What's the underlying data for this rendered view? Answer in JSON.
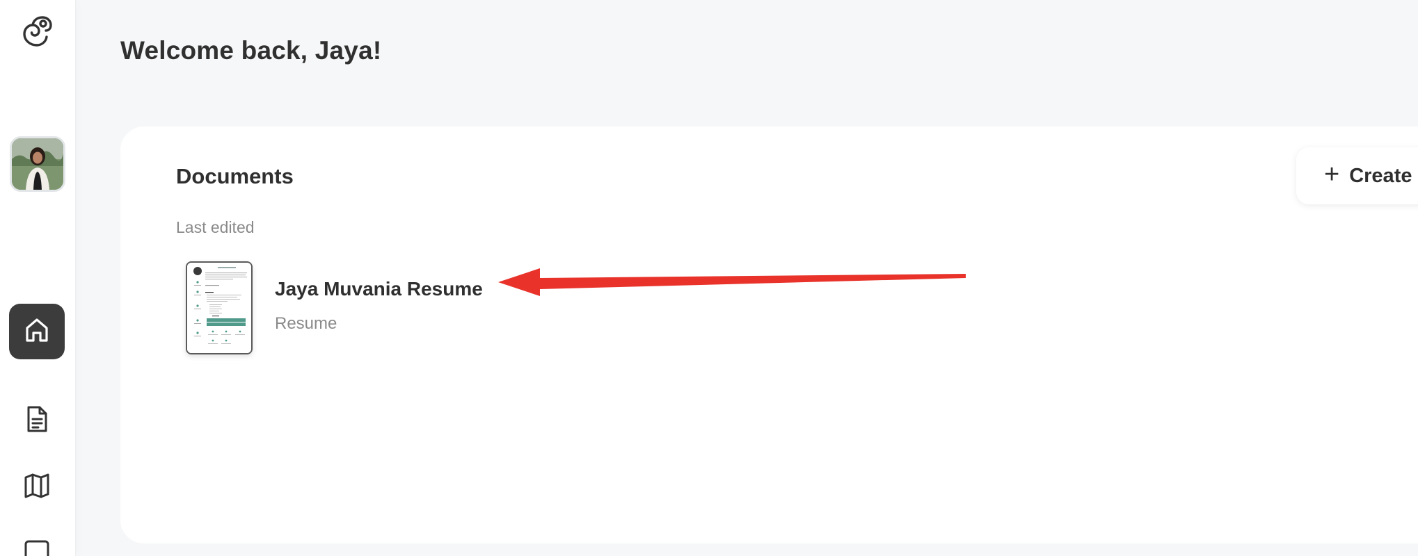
{
  "sidebar": {
    "logo_icon": "spiral-logo-icon",
    "nav": [
      {
        "icon": "home-icon",
        "active": true
      },
      {
        "icon": "document-icon",
        "active": false
      },
      {
        "icon": "map-icon",
        "active": false
      },
      {
        "icon": "square-icon",
        "active": false
      }
    ]
  },
  "header": {
    "welcome": "Welcome back, Jaya!"
  },
  "documents": {
    "title": "Documents",
    "create_label": "Create",
    "subhead": "Last edited",
    "items": [
      {
        "title": "Jaya Muvania Resume",
        "type": "Resume"
      }
    ]
  },
  "colors": {
    "accent_active": "#3c3c3c",
    "annotation_arrow": "#e8322a",
    "resume_accent": "#4f9a8a"
  }
}
